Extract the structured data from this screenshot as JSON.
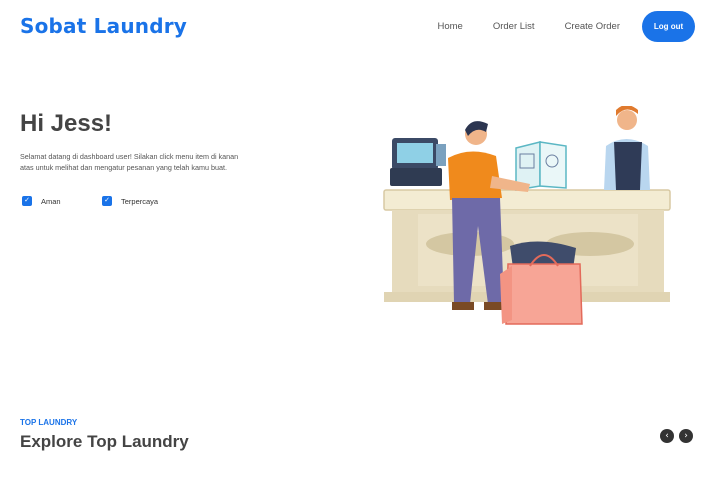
{
  "navbar": {
    "brand": "Sobat Laundry",
    "links": [
      "Home",
      "Order List",
      "Create Order"
    ],
    "logout_label": "Log out"
  },
  "hero": {
    "greeting": "Hi Jess!",
    "description": "Selamat datang di dashboard user! Silakan click menu item di kanan atas untuk melihat dan mengatur pesanan yang telah kamu buat.",
    "features": [
      "Aman",
      "Terpercaya"
    ]
  },
  "section": {
    "kicker": "TOP LAUNDRY",
    "title": "Explore Top Laundry"
  },
  "colors": {
    "accent": "#1a73e8"
  },
  "icons": {
    "check": "check-icon",
    "prev": "chevron-left-icon",
    "next": "chevron-right-icon"
  }
}
